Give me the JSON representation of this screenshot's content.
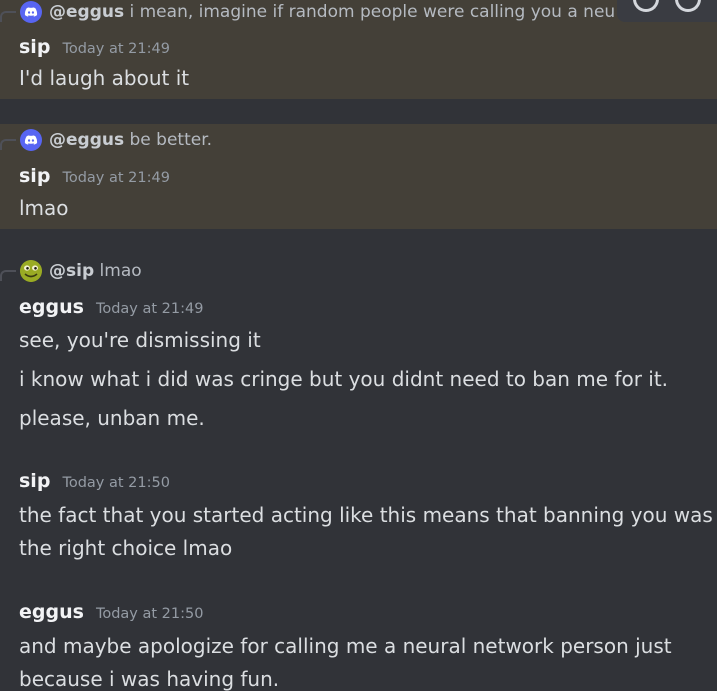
{
  "colors": {
    "background": "#313338",
    "highlight": "#444038",
    "username": "#f2f3f5",
    "timestamp": "#949ba4",
    "text": "#dbdee1",
    "discord_blurple": "#5865f2"
  },
  "messages": [
    {
      "reply": {
        "avatar_icon": "discord-icon",
        "name": "@eggus",
        "text": "i mean, imagine if random people were calling you a neu"
      },
      "author": "sip",
      "timestamp": "Today at 21:49",
      "lines": [
        "I'd laugh about it"
      ]
    },
    {
      "reply": {
        "avatar_icon": "discord-icon",
        "name": "@eggus",
        "text": "be better."
      },
      "author": "sip",
      "timestamp": "Today at 21:49",
      "lines": [
        "lmao"
      ]
    },
    {
      "reply": {
        "avatar_icon": "frog-avatar-icon",
        "name": "@sip",
        "text": "lmao"
      },
      "author": "eggus",
      "timestamp": "Today at 21:49",
      "lines": [
        "see, you're dismissing it",
        "i know what i did was cringe but you didnt need to ban me for it.",
        "please, unban me."
      ]
    },
    {
      "author": "sip",
      "timestamp": "Today at 21:50",
      "lines": [
        "the fact that you started acting like this means that banning you was the right choice lmao"
      ]
    },
    {
      "author": "eggus",
      "timestamp": "Today at 21:50",
      "lines": [
        "and maybe apologize for calling me a neural network person just because i was having fun."
      ]
    }
  ]
}
